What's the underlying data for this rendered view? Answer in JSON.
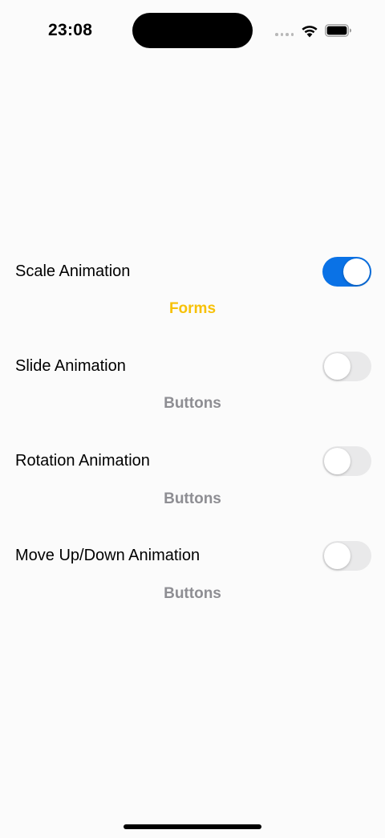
{
  "status_bar": {
    "time": "23:08",
    "icons": [
      "signal-dots-icon",
      "wifi-icon",
      "battery-icon"
    ]
  },
  "colors": {
    "toggle_on": "#0a72e6",
    "toggle_off": "#e9e9ea",
    "active_caption": "#f7c107",
    "inactive_caption": "#8e8e93"
  },
  "settings": [
    {
      "label": "Scale Animation",
      "enabled": true,
      "caption": "Forms"
    },
    {
      "label": "Slide Animation",
      "enabled": false,
      "caption": "Buttons"
    },
    {
      "label": "Rotation Animation",
      "enabled": false,
      "caption": "Buttons"
    },
    {
      "label": "Move Up/Down Animation",
      "enabled": false,
      "caption": "Buttons"
    }
  ]
}
